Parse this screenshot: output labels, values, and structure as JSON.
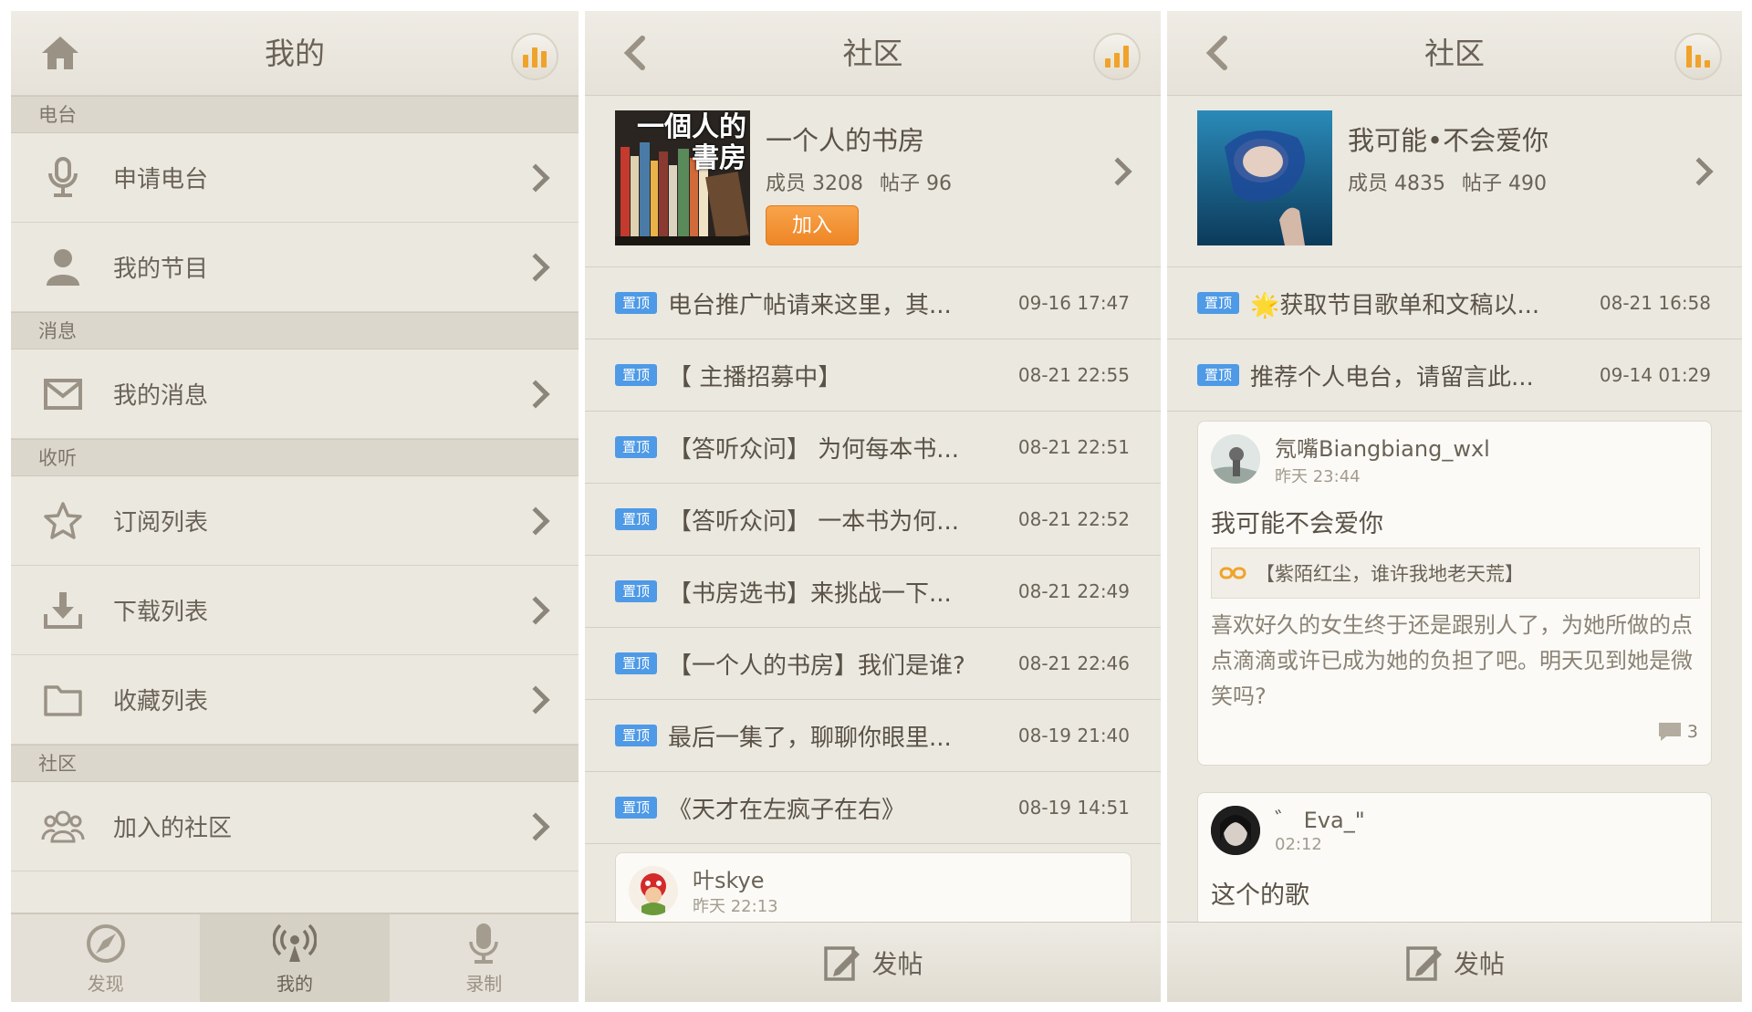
{
  "panel1": {
    "title": "我的",
    "sections": [
      {
        "label": "电台"
      },
      {
        "label": "消息"
      },
      {
        "label": "收听"
      },
      {
        "label": "社区"
      }
    ],
    "items": [
      {
        "label": "申请电台",
        "icon": "microphone-icon"
      },
      {
        "label": "我的节目",
        "icon": "user-icon"
      },
      {
        "label": "我的消息",
        "icon": "envelope-icon"
      },
      {
        "label": "订阅列表",
        "icon": "star-icon"
      },
      {
        "label": "下载列表",
        "icon": "download-icon"
      },
      {
        "label": "收藏列表",
        "icon": "folder-icon"
      },
      {
        "label": "加入的社区",
        "icon": "group-icon"
      }
    ],
    "tabs": [
      {
        "label": "发现",
        "icon": "compass-icon"
      },
      {
        "label": "我的",
        "icon": "radio-icon"
      },
      {
        "label": "录制",
        "icon": "mic-icon"
      }
    ]
  },
  "panel2": {
    "title": "社区",
    "community": {
      "name": "一个人的书房",
      "members_label": "成员 3208",
      "posts_label": "帖子 96",
      "join_label": "加入",
      "cover_text": "一個人的書房"
    },
    "pin_label": "置顶",
    "posts": [
      {
        "title": "电台推广帖请来这里，其...",
        "time": "09-16 17:47"
      },
      {
        "title": "【 主播招募中】",
        "time": "08-21 22:55"
      },
      {
        "title": "【答听众问】 为何每本书...",
        "time": "08-21 22:51"
      },
      {
        "title": "【答听众问】 一本书为何...",
        "time": "08-21 22:52"
      },
      {
        "title": "【书房选书】来挑战一下...",
        "time": "08-21 22:49"
      },
      {
        "title": "【一个人的书房】我们是谁?",
        "time": "08-21 22:46"
      },
      {
        "title": "最后一集了，聊聊你眼里...",
        "time": "08-19 21:40"
      },
      {
        "title": "《天才在左疯子在右》",
        "time": "08-19 14:51"
      }
    ],
    "user_card": {
      "name": "叶skye",
      "time": "昨天 22:13"
    },
    "post_button": "发帖"
  },
  "panel3": {
    "title": "社区",
    "community": {
      "name": "我可能•不会爱你",
      "members_label": "成员 4835",
      "posts_label": "帖子 490"
    },
    "pin_label": "置顶",
    "posts": [
      {
        "title": "🌟获取节目歌单和文稿以...",
        "time": "08-21 16:58"
      },
      {
        "title": "推荐个人电台，请留言此...",
        "time": "09-14 01:29"
      }
    ],
    "card1": {
      "name": "氖嘴Biangbiang_wxl",
      "time": "昨天 23:44",
      "title": "我可能不会爱你",
      "link": "【紫陌红尘，谁许我地老天荒】",
      "body": "喜欢好久的女生终于还是跟别人了，为她所做的点点滴滴或许已成为她的负担了吧。明天见到她是微笑吗?",
      "comments": "3"
    },
    "card2": {
      "name": "゛ Eva_\"",
      "time": "02:12",
      "title": "这个的歌"
    },
    "post_button": "发帖"
  }
}
